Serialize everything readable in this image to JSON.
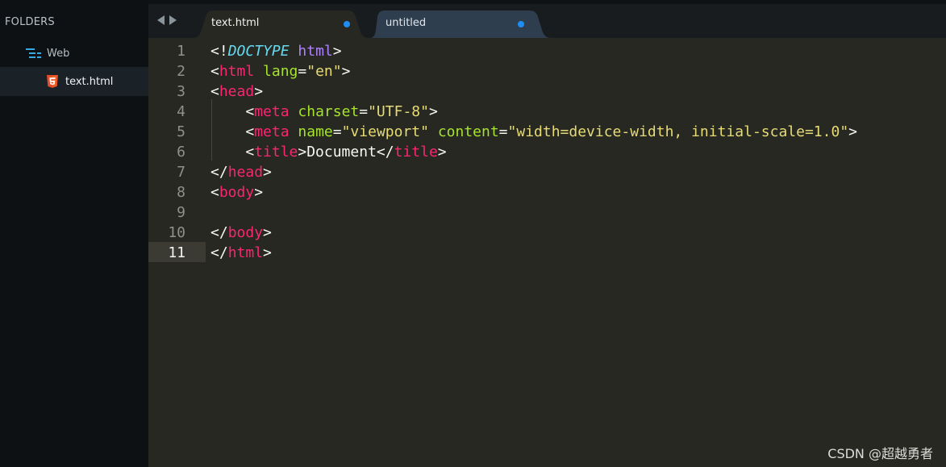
{
  "sidebar": {
    "title": "FOLDERS",
    "folder": {
      "label": "Web",
      "icon": "folder-tree-icon"
    },
    "file": {
      "label": "text.html",
      "icon": "html5-icon"
    }
  },
  "tabs": [
    {
      "label": "text.html",
      "modified": true,
      "active": true
    },
    {
      "label": "untitled",
      "modified": true,
      "active": false
    }
  ],
  "editor": {
    "current_line": 11,
    "line_numbers": [
      "1",
      "2",
      "3",
      "4",
      "5",
      "6",
      "7",
      "8",
      "9",
      "10",
      "11"
    ],
    "lines": [
      [
        {
          "t": "<!",
          "c": "text"
        },
        {
          "t": "DOCTYPE",
          "c": "doctype"
        },
        {
          "t": " ",
          "c": "text"
        },
        {
          "t": "html",
          "c": "kw"
        },
        {
          "t": ">",
          "c": "text"
        }
      ],
      [
        {
          "t": "<",
          "c": "text"
        },
        {
          "t": "html",
          "c": "tag"
        },
        {
          "t": " ",
          "c": "text"
        },
        {
          "t": "lang",
          "c": "attr"
        },
        {
          "t": "=",
          "c": "text"
        },
        {
          "t": "\"en\"",
          "c": "str"
        },
        {
          "t": ">",
          "c": "text"
        }
      ],
      [
        {
          "t": "<",
          "c": "text"
        },
        {
          "t": "head",
          "c": "tag"
        },
        {
          "t": ">",
          "c": "text"
        }
      ],
      [
        {
          "t": "    <",
          "c": "text"
        },
        {
          "t": "meta",
          "c": "tag"
        },
        {
          "t": " ",
          "c": "text"
        },
        {
          "t": "charset",
          "c": "attr"
        },
        {
          "t": "=",
          "c": "text"
        },
        {
          "t": "\"UTF-8\"",
          "c": "str"
        },
        {
          "t": ">",
          "c": "text"
        }
      ],
      [
        {
          "t": "    <",
          "c": "text"
        },
        {
          "t": "meta",
          "c": "tag"
        },
        {
          "t": " ",
          "c": "text"
        },
        {
          "t": "name",
          "c": "attr"
        },
        {
          "t": "=",
          "c": "text"
        },
        {
          "t": "\"viewport\"",
          "c": "str"
        },
        {
          "t": " ",
          "c": "text"
        },
        {
          "t": "content",
          "c": "attr"
        },
        {
          "t": "=",
          "c": "text"
        },
        {
          "t": "\"width=device-width, initial-scale=1.0\"",
          "c": "str"
        },
        {
          "t": ">",
          "c": "text"
        }
      ],
      [
        {
          "t": "    <",
          "c": "text"
        },
        {
          "t": "title",
          "c": "tag"
        },
        {
          "t": ">Document</",
          "c": "text"
        },
        {
          "t": "title",
          "c": "tag"
        },
        {
          "t": ">",
          "c": "text"
        }
      ],
      [
        {
          "t": "</",
          "c": "text"
        },
        {
          "t": "head",
          "c": "tag"
        },
        {
          "t": ">",
          "c": "text"
        }
      ],
      [
        {
          "t": "<",
          "c": "text"
        },
        {
          "t": "body",
          "c": "tag"
        },
        {
          "t": ">",
          "c": "text"
        }
      ],
      [],
      [
        {
          "t": "</",
          "c": "text"
        },
        {
          "t": "body",
          "c": "tag"
        },
        {
          "t": ">",
          "c": "text"
        }
      ],
      [
        {
          "t": "</",
          "c": "text"
        },
        {
          "t": "html",
          "c": "tag"
        },
        {
          "t": ">",
          "c": "text"
        }
      ]
    ]
  },
  "colors": {
    "background": "#272822",
    "sidebar": "#0d1114",
    "tag": "#f92672",
    "attribute": "#a6e22e",
    "string": "#e6db74",
    "doctype": "#66d9ef",
    "keyword": "#ae81ff",
    "modified_dot": "#1e8ef2"
  },
  "watermark": "CSDN @超越勇者"
}
